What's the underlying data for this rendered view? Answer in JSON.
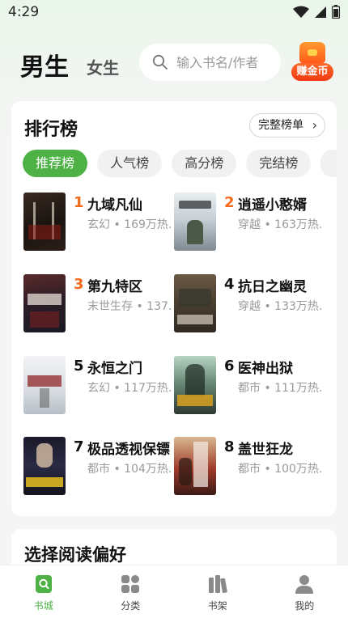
{
  "status_bar": {
    "time": "4:29"
  },
  "header": {
    "tab_male": "男生",
    "tab_female": "女生",
    "search_placeholder": "输入书名/作者",
    "earn_coins_label": "赚金币"
  },
  "ranking": {
    "title": "排行榜",
    "full_list_label": "完整榜单",
    "chips": [
      "推荐榜",
      "人气榜",
      "高分榜",
      "完结榜"
    ],
    "active_chip": "推荐榜",
    "books": [
      {
        "rank": "1",
        "name": "九域凡仙",
        "meta": "玄幻 • 169万热..."
      },
      {
        "rank": "2",
        "name": "逍遥小憨婿",
        "meta": "穿越 • 163万热..."
      },
      {
        "rank": "3",
        "name": "第九特区",
        "meta": "末世生存 • 137..."
      },
      {
        "rank": "4",
        "name": "抗日之幽灵",
        "meta": "穿越 • 133万热..."
      },
      {
        "rank": "5",
        "name": "永恒之门",
        "meta": "玄幻 • 117万热..."
      },
      {
        "rank": "6",
        "name": "医神出狱",
        "meta": "都市 • 111万热..."
      },
      {
        "rank": "7",
        "name": "极品透视保镖",
        "meta": "都市 • 104万热..."
      },
      {
        "rank": "8",
        "name": "盖世狂龙",
        "meta": "都市 • 100万热..."
      }
    ]
  },
  "preference": {
    "title": "选择阅读偏好"
  },
  "bottom_nav": {
    "items": [
      {
        "label": "书城",
        "icon": "bookstore-icon"
      },
      {
        "label": "分类",
        "icon": "category-grid-icon"
      },
      {
        "label": "书架",
        "icon": "bookshelf-icon"
      },
      {
        "label": "我的",
        "icon": "profile-icon"
      }
    ],
    "active": "书城"
  },
  "colors": {
    "accent": "#4db145",
    "rank_hot": "#f26a1c",
    "coin_orange": "#f04a18"
  }
}
